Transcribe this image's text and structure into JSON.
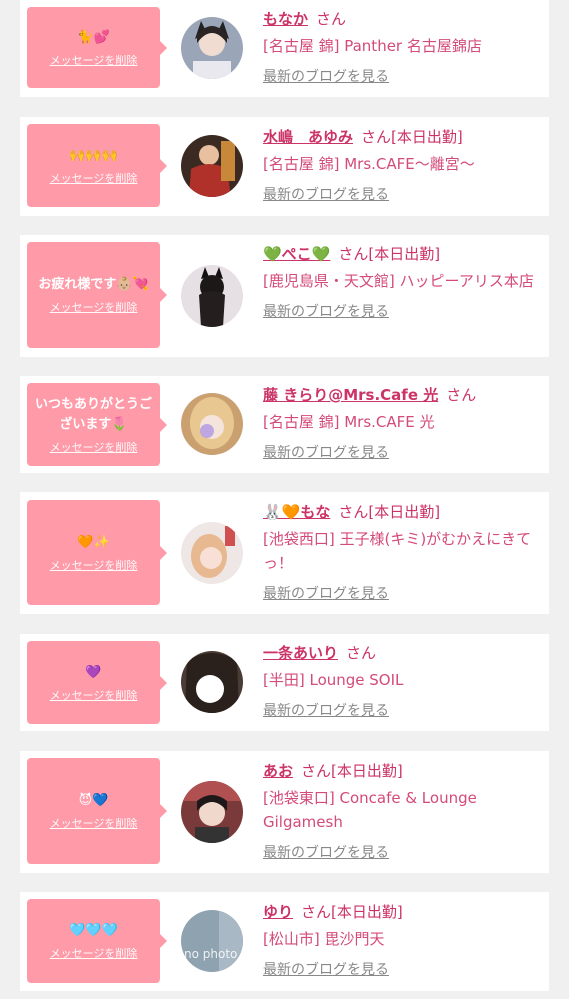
{
  "cards": [
    {
      "message": "🐈💕",
      "delete": "メッセージを削除",
      "name": "もなか",
      "san": "さん",
      "today": "",
      "shop": "[名古屋 錦] Panther 名古屋錦店",
      "blog": "最新のブログを見る",
      "avatar_color": "#9aa6b8"
    },
    {
      "message": "🙌🙌🙌",
      "delete": "メッセージを削除",
      "name": "水嶋　あゆみ",
      "san": "さん",
      "today": "[本日出勤]",
      "shop": "[名古屋 錦] Mrs.CAFE〜離宮〜",
      "blog": "最新のブログを見る",
      "avatar_color": "#a8332c"
    },
    {
      "message": "お疲れ様です👶🏼💘",
      "delete": "メッセージを削除",
      "name": "💚ぺこ💚",
      "san": "さん",
      "today": "[本日出勤]",
      "shop": "[鹿児島県・天文館] ハッピーアリス本店",
      "blog": "最新のブログを見る",
      "avatar_color": "#d8d2d8"
    },
    {
      "message": "いつもありがとうございます🌷",
      "delete": "メッセージを削除",
      "name": "藤 きらり@Mrs.Cafe 光",
      "san": "さん",
      "today": "",
      "shop": "[名古屋 錦] Mrs.CAFE 光",
      "blog": "最新のブログを見る",
      "avatar_color": "#c89a60"
    },
    {
      "message": "🧡✨",
      "delete": "メッセージを削除",
      "name": "🐰🧡もな",
      "san": "さん",
      "today": "[本日出勤]",
      "shop": "[池袋西口] 王子様(キミ)がむかえにきてっ！",
      "blog": "最新のブログを見る",
      "avatar_color": "#e6c4c0"
    },
    {
      "message": "💜",
      "delete": "メッセージを削除",
      "name": "一条あいり",
      "san": "さん",
      "today": "",
      "shop": "[半田] Lounge SOIL",
      "blog": "最新のブログを見る",
      "avatar_color": "#4a3c34"
    },
    {
      "message": "😈💙",
      "delete": "メッセージを削除",
      "name": "あお",
      "san": "さん",
      "today": "[本日出勤]",
      "shop": "[池袋東口] Concafe & Lounge Gilgamesh",
      "blog": "最新のブログを見る",
      "avatar_color": "#7a3a3a"
    },
    {
      "message": "🩵🩵🩵",
      "delete": "メッセージを削除",
      "name": "ゆり",
      "san": "さん",
      "today": "[本日出勤]",
      "shop": "[松山市] 毘沙門天",
      "blog": "最新のブログを見る",
      "avatar_color": "#8fa2b0",
      "avatar_text": "no photo"
    }
  ],
  "colors": {
    "bubble": "#ff9aa8",
    "accent": "#cc3366",
    "background": "#f0f0f0"
  }
}
